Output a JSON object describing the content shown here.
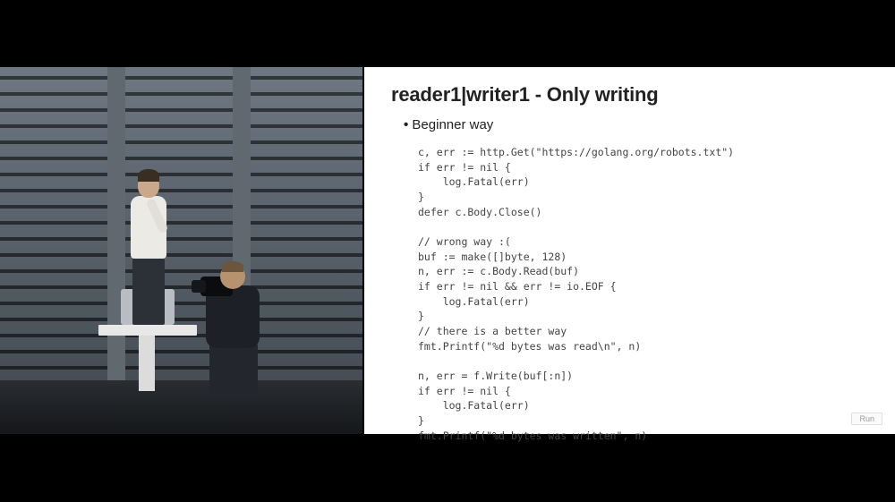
{
  "slide": {
    "title": "reader1|writer1 - Only writing",
    "bullet": "Beginner way",
    "code": "c, err := http.Get(\"https://golang.org/robots.txt\")\nif err != nil {\n    log.Fatal(err)\n}\ndefer c.Body.Close()\n\n// wrong way :(\nbuf := make([]byte, 128)\nn, err := c.Body.Read(buf)\nif err != nil && err != io.EOF {\n    log.Fatal(err)\n}\n// there is a better way\nfmt.Printf(\"%d bytes was read\\n\", n)\n\nn, err = f.Write(buf[:n])\nif err != nil {\n    log.Fatal(err)\n}\nfmt.Printf(\"%d bytes was written\", n)",
    "run_label": "Run"
  }
}
